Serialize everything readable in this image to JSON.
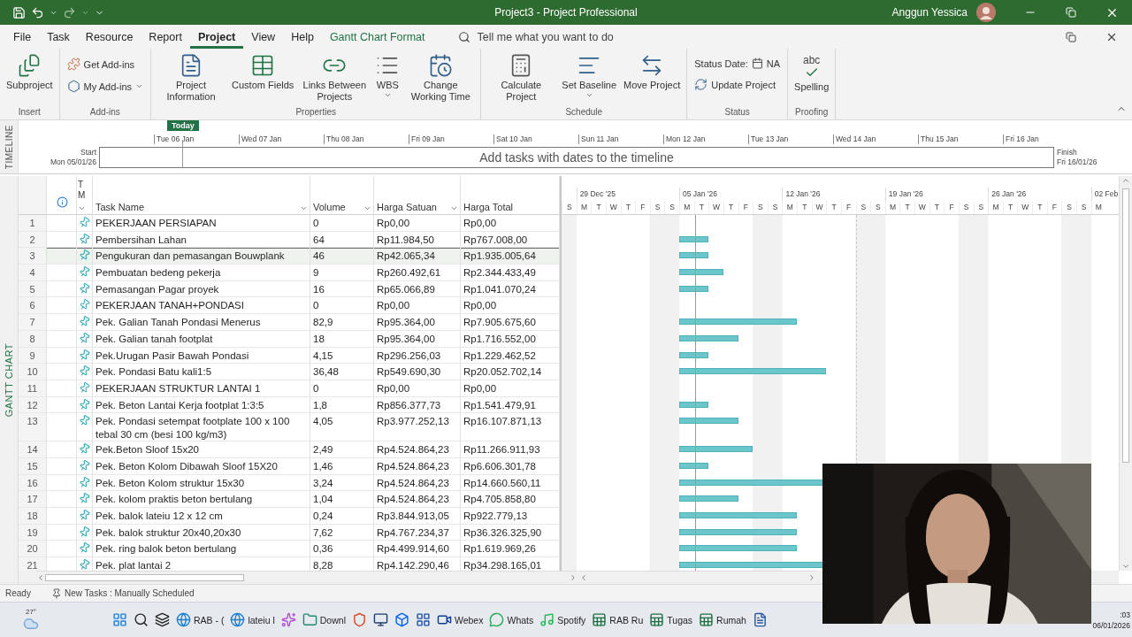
{
  "title_bar": {
    "title": "Project3  -  Project Professional",
    "user": "Anggun Yessica"
  },
  "menu": {
    "tabs": [
      {
        "label": "File",
        "selected": false,
        "kind": "normal"
      },
      {
        "label": "Task",
        "selected": false,
        "kind": "normal"
      },
      {
        "label": "Resource",
        "selected": false,
        "kind": "normal"
      },
      {
        "label": "Report",
        "selected": false,
        "kind": "normal"
      },
      {
        "label": "Project",
        "selected": true,
        "kind": "normal"
      },
      {
        "label": "View",
        "selected": false,
        "kind": "normal"
      },
      {
        "label": "Help",
        "selected": false,
        "kind": "normal"
      },
      {
        "label": "Gantt Chart Format",
        "selected": false,
        "kind": "contextual"
      }
    ],
    "tell_me": {
      "placeholder": "Tell me what you want to do"
    }
  },
  "ribbon": {
    "groups": [
      {
        "label": "Insert",
        "buttons": [
          {
            "kind": "large",
            "label": "Subproject",
            "dropdown": false
          }
        ]
      },
      {
        "label": "Add-ins",
        "buttons": [
          {
            "kind": "small",
            "label": "Get Add-ins",
            "dropdown": false
          },
          {
            "kind": "small",
            "label": "My Add-ins",
            "dropdown": true
          }
        ]
      },
      {
        "label": "Properties",
        "buttons": [
          {
            "kind": "large",
            "label": "Project Information",
            "dropdown": false
          },
          {
            "kind": "large",
            "label": "Custom Fields",
            "dropdown": false
          },
          {
            "kind": "large",
            "label": "Links Between Projects",
            "dropdown": false
          },
          {
            "kind": "large",
            "label": "WBS",
            "dropdown": true
          },
          {
            "kind": "large",
            "label": "Change Working Time",
            "dropdown": false
          }
        ]
      },
      {
        "label": "Schedule",
        "buttons": [
          {
            "kind": "large",
            "label": "Calculate Project",
            "dropdown": false
          },
          {
            "kind": "large",
            "label": "Set Baseline",
            "dropdown": true
          },
          {
            "kind": "large",
            "label": "Move Project",
            "dropdown": false
          }
        ]
      },
      {
        "label": "Status",
        "buttons": [
          {
            "kind": "status_date",
            "label": "Status Date:",
            "value": "NA",
            "dropdown": false
          },
          {
            "kind": "small",
            "label": "Update Project",
            "dropdown": false
          }
        ]
      },
      {
        "label": "Proofing",
        "buttons": [
          {
            "kind": "spelling",
            "label": "Spelling",
            "icon_text": "abc"
          }
        ]
      }
    ]
  },
  "timeline": {
    "label": "TIMELINE",
    "today": "Today",
    "start_label": "Start",
    "start_date": "Mon 05/01/26",
    "finish_label": "Finish",
    "finish_date": "Fri 16/01/26",
    "message": "Add tasks with dates to the timeline",
    "ticks": [
      "Tue 06 Jan",
      "Wed 07 Jan",
      "Thu 08 Jan",
      "Fri 09 Jan",
      "Sat 10 Jan",
      "Sun 11 Jan",
      "Mon 12 Jan",
      "Tue 13 Jan",
      "Wed 14 Jan",
      "Thu 15 Jan",
      "Fri 16 Jan"
    ]
  },
  "grid": {
    "view_label": "GANTT CHART",
    "columns": [
      {
        "kind": "indicators"
      },
      {
        "kind": "mode",
        "label": "T M",
        "filter": true
      },
      {
        "kind": "text",
        "label": "Task Name",
        "filter": true
      },
      {
        "kind": "text",
        "label": "Volume",
        "filter": true
      },
      {
        "kind": "text",
        "label": "Harga Satuan",
        "filter": true
      },
      {
        "kind": "text",
        "label": "Harga Total",
        "filter": false
      }
    ],
    "rows": [
      {
        "id": "1",
        "kind": "manual_no_dates",
        "task_name": "PEKERJAAN PERSIAPAN",
        "volume": "0",
        "harga_satuan": "Rp0,00",
        "harga_total": "Rp0,00",
        "selected": false
      },
      {
        "id": "2",
        "kind": "manual",
        "task_name": "Pembersihan Lahan",
        "volume": "64",
        "harga_satuan": "Rp11.984,50",
        "harga_total": "Rp767.008,00",
        "selected": false
      },
      {
        "id": "3",
        "kind": "manual",
        "task_name": "Pengukuran dan pemasangan Bouwplank",
        "volume": "46",
        "harga_satuan": "Rp42.065,34",
        "harga_total": "Rp1.935.005,64",
        "selected": true
      },
      {
        "id": "4",
        "kind": "manual",
        "task_name": "Pembuatan bedeng pekerja",
        "volume": "9",
        "harga_satuan": "Rp260.492,61",
        "harga_total": "Rp2.344.433,49",
        "selected": false
      },
      {
        "id": "5",
        "kind": "manual",
        "task_name": "Pemasangan Pagar proyek",
        "volume": "16",
        "harga_satuan": "Rp65.066,89",
        "harga_total": "Rp1.041.070,24",
        "selected": false
      },
      {
        "id": "6",
        "kind": "manual_no_dates",
        "task_name": "PEKERJAAN TANAH+PONDASI",
        "volume": "0",
        "harga_satuan": "Rp0,00",
        "harga_total": "Rp0,00",
        "selected": false
      },
      {
        "id": "7",
        "kind": "manual",
        "task_name": "Pek. Galian Tanah Pondasi Menerus",
        "volume": "82,9",
        "harga_satuan": "Rp95.364,00",
        "harga_total": "Rp7.905.675,60",
        "selected": false
      },
      {
        "id": "8",
        "kind": "manual",
        "task_name": "Pek. Galian tanah footplat",
        "volume": "18",
        "harga_satuan": "Rp95.364,00",
        "harga_total": "Rp1.716.552,00",
        "selected": false
      },
      {
        "id": "9",
        "kind": "manual",
        "task_name": "Pek.Urugan Pasir Bawah Pondasi",
        "volume": "4,15",
        "harga_satuan": "Rp296.256,03",
        "harga_total": "Rp1.229.462,52",
        "selected": false
      },
      {
        "id": "10",
        "kind": "manual",
        "task_name": "Pek. Pondasi Batu kali1:5",
        "volume": "36,48",
        "harga_satuan": "Rp549.690,30",
        "harga_total": "Rp20.052.702,14",
        "selected": false
      },
      {
        "id": "11",
        "kind": "manual_no_dates",
        "task_name": "PEKERJAAN STRUKTUR LANTAI 1",
        "volume": "0",
        "harga_satuan": "Rp0,00",
        "harga_total": "Rp0,00",
        "selected": false
      },
      {
        "id": "12",
        "kind": "manual",
        "task_name": "Pek. Beton Lantai Kerja footplat 1:3:5",
        "volume": "1,8",
        "harga_satuan": "Rp856.377,73",
        "harga_total": "Rp1.541.479,91",
        "selected": false
      },
      {
        "id": "13",
        "kind": "manual",
        "task_name": "Pek. Pondasi setempat footplate 100 x 100 tebal 30 cm (besi 100 kg/m3)",
        "volume": "4,05",
        "harga_satuan": "Rp3.977.252,13",
        "harga_total": "Rp16.107.871,13",
        "selected": false
      },
      {
        "id": "14",
        "kind": "manual",
        "task_name": "Pek.Beton Sloof 15x20",
        "volume": "2,49",
        "harga_satuan": "Rp4.524.864,23",
        "harga_total": "Rp11.266.911,93",
        "selected": false
      },
      {
        "id": "15",
        "kind": "manual",
        "task_name": "Pek. Beton Kolom Dibawah Sloof 15X20",
        "volume": "1,46",
        "harga_satuan": "Rp4.524.864,23",
        "harga_total": "Rp6.606.301,78",
        "selected": false
      },
      {
        "id": "16",
        "kind": "manual",
        "task_name": "Pek. Beton Kolom struktur 15x30",
        "volume": "3,24",
        "harga_satuan": "Rp4.524.864,23",
        "harga_total": "Rp14.660.560,11",
        "selected": false
      },
      {
        "id": "17",
        "kind": "manual",
        "task_name": "Pek. kolom praktis beton bertulang",
        "volume": "1,04",
        "harga_satuan": "Rp4.524.864,23",
        "harga_total": "Rp4.705.858,80",
        "selected": false
      },
      {
        "id": "18",
        "kind": "manual",
        "task_name": "Pek. balok lateiu 12 x 12 cm",
        "volume": "0,24",
        "harga_satuan": "Rp3.844.913,05",
        "harga_total": "Rp922.779,13",
        "selected": false
      },
      {
        "id": "19",
        "kind": "manual",
        "task_name": "Pek. balok struktur  20x40,20x30",
        "volume": "7,62",
        "harga_satuan": "Rp4.767.234,37",
        "harga_total": "Rp36.326.325,90",
        "selected": false
      },
      {
        "id": "20",
        "kind": "manual",
        "task_name": "Pek. ring balok beton bertulang",
        "volume": "0,36",
        "harga_satuan": "Rp4.499.914,60",
        "harga_total": "Rp1.619.969,26",
        "selected": false
      },
      {
        "id": "21",
        "kind": "manual",
        "task_name": "Pek. plat lantai 2",
        "volume": "8,28",
        "harga_satuan": "Rp4.142.290,46",
        "harga_total": "Rp34.298.165,01",
        "selected": false
      }
    ]
  },
  "gantt": {
    "weeks": [
      "29 Dec '25",
      "05 Jan '26",
      "12 Jan '26",
      "19 Jan '26",
      "26 Jan '26",
      "02 Feb"
    ],
    "days": [
      "S",
      "M",
      "T",
      "W",
      "T",
      "F",
      "S",
      "S",
      "M",
      "T",
      "W",
      "T",
      "F",
      "S",
      "S",
      "M",
      "T",
      "W",
      "T",
      "F",
      "S",
      "S",
      "M",
      "T",
      "W",
      "T",
      "F",
      "S",
      "S",
      "M",
      "T",
      "W",
      "T",
      "F",
      "S",
      "S",
      "M"
    ]
  },
  "status_bar": {
    "state": "Ready",
    "new_tasks": "New Tasks : Manually Scheduled"
  },
  "taskbar": {
    "weather": "27°",
    "apps": [
      {
        "kind": "start"
      },
      {
        "kind": "search"
      },
      {
        "kind": "taskview"
      },
      {
        "kind": "browser",
        "label": "RAB - ("
      },
      {
        "kind": "browser",
        "label": "lateiu l"
      },
      {
        "kind": "assistant"
      },
      {
        "kind": "folder",
        "label": "Downl"
      },
      {
        "kind": "office"
      },
      {
        "kind": "monitor"
      },
      {
        "kind": "dropbox"
      },
      {
        "kind": "grid"
      },
      {
        "kind": "video",
        "label": "Webex"
      },
      {
        "kind": "chat",
        "label": "Whats"
      },
      {
        "kind": "music",
        "label": "Spotify"
      },
      {
        "kind": "sheet",
        "label": "RAB Ru"
      },
      {
        "kind": "sheet",
        "label": "Tugas"
      },
      {
        "kind": "sheet",
        "label": "Rumah"
      },
      {
        "kind": "doc"
      }
    ],
    "time": ":03",
    "date": "06/01/2026"
  }
}
